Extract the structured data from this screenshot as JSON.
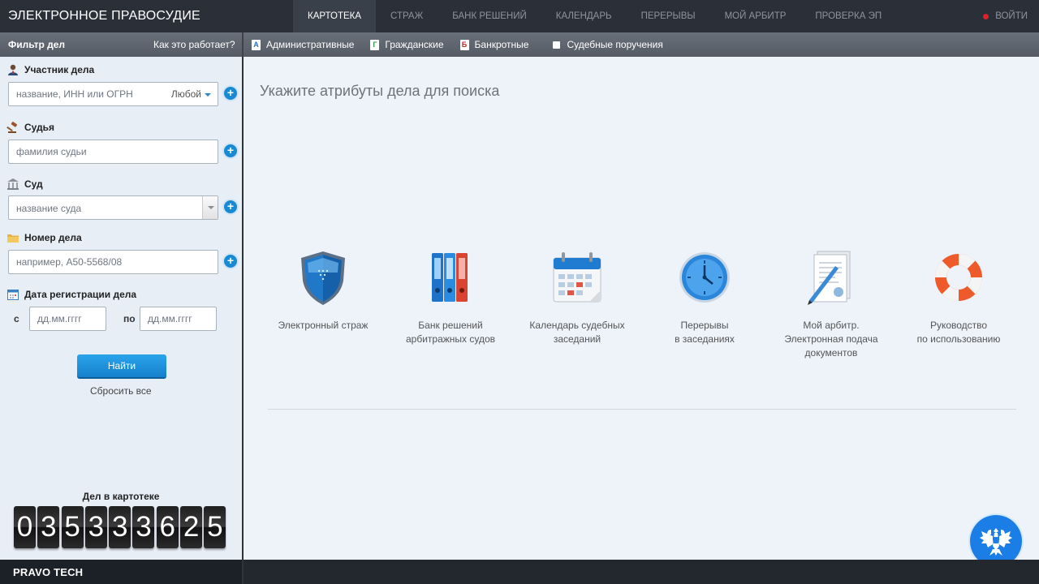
{
  "app": {
    "title": "ЭЛЕКТРОННОЕ ПРАВОСУДИЕ"
  },
  "nav": {
    "items": [
      "КАРТОТЕКА",
      "СТРАЖ",
      "БАНК РЕШЕНИЙ",
      "КАЛЕНДАРЬ",
      "ПЕРЕРЫВЫ",
      "МОЙ АРБИТР",
      "ПРОВЕРКА ЭП"
    ],
    "active": "КАРТОТЕКА",
    "login": "ВОЙТИ"
  },
  "filter": {
    "title": "Фильтр дел",
    "help_link": "Как это работает?",
    "participant": {
      "label": "Участник дела",
      "placeholder": "название, ИНН или ОГРН",
      "role": "Любой"
    },
    "judge": {
      "label": "Судья",
      "placeholder": "фамилия судьи"
    },
    "court": {
      "label": "Суд",
      "placeholder": "название суда"
    },
    "case_number": {
      "label": "Номер дела",
      "placeholder": "например, А50-5568/08"
    },
    "reg_date": {
      "label": "Дата регистрации дела",
      "from_label": "с",
      "to_label": "по",
      "from_placeholder": "дд.мм.гггг",
      "to_placeholder": "дд.мм.гггг"
    },
    "find_button": "Найти",
    "reset_link": "Сбросить все"
  },
  "case_types": [
    {
      "badge": "А",
      "label": "Административные"
    },
    {
      "badge": "Г",
      "label": "Гражданские"
    },
    {
      "badge": "Б",
      "label": "Банкротные"
    },
    {
      "badge": "",
      "label": "Судебные поручения"
    }
  ],
  "counter": {
    "title": "Дел в картотеке",
    "digits": [
      "0",
      "3",
      "5",
      "3",
      "3",
      "3",
      "6",
      "2",
      "5"
    ]
  },
  "main": {
    "prompt": "Укажите атрибуты дела для поиска",
    "tiles": [
      {
        "icon": "shield-icon",
        "caption": "Электронный страж"
      },
      {
        "icon": "binders-icon",
        "caption": "Банк решений\nарбитражных судов"
      },
      {
        "icon": "calendar-icon",
        "caption": "Календарь судебных\nзаседаний"
      },
      {
        "icon": "clock-icon",
        "caption": "Перерывы\nв заседаниях"
      },
      {
        "icon": "document-pen-icon",
        "caption": "Мой арбитр.\nЭлектронная подача\nдокументов"
      },
      {
        "icon": "lifebuoy-icon",
        "caption": "Руководство\nпо использованию"
      }
    ]
  },
  "footer": {
    "brand": "PRAVO TECH"
  },
  "colors": {
    "accent": "#1a89d3",
    "topbar": "#2a2f38",
    "danger": "#d9232a"
  }
}
